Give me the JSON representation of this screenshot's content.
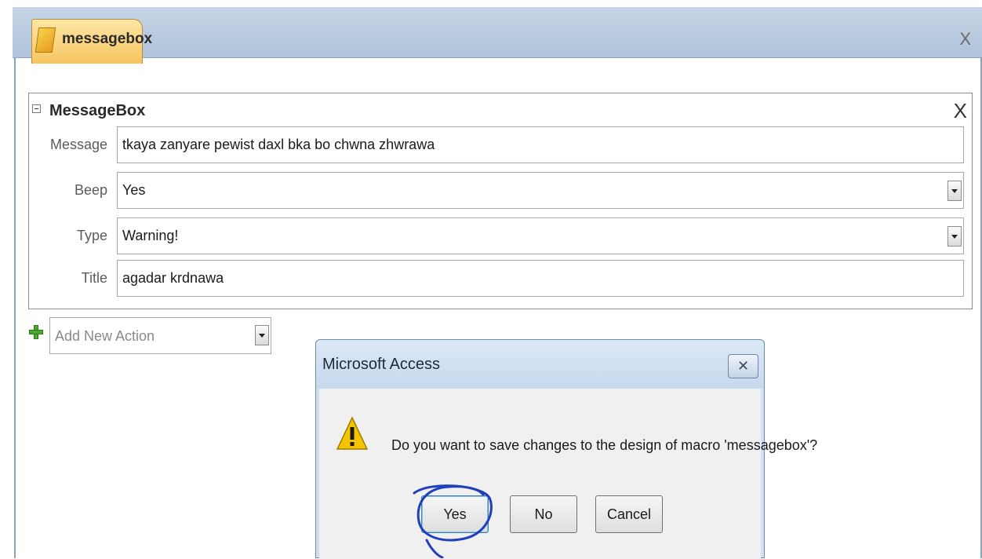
{
  "document_tab": {
    "label": "messagebox",
    "close_label": "X"
  },
  "action": {
    "name": "MessageBox",
    "delete_label": "X",
    "arguments": [
      {
        "label": "Message",
        "value": "tkaya zanyare pewist daxl bka bo chwna zhwrawa",
        "dropdown": false
      },
      {
        "label": "Beep",
        "value": "Yes",
        "dropdown": true
      },
      {
        "label": "Type",
        "value": "Warning!",
        "dropdown": true
      },
      {
        "label": "Title",
        "value": "agadar krdnawa",
        "dropdown": false
      }
    ]
  },
  "add_action": {
    "placeholder": "Add New Action"
  },
  "dialog": {
    "title": "Microsoft Access",
    "close_label": "✕",
    "message": "Do you want to save changes to the design of macro 'messagebox'?",
    "buttons": {
      "yes": "Yes",
      "no": "No",
      "cancel": "Cancel"
    }
  },
  "colors": {
    "tab_accent": "#f7c561",
    "annotation_ink": "#1f3fbf"
  }
}
